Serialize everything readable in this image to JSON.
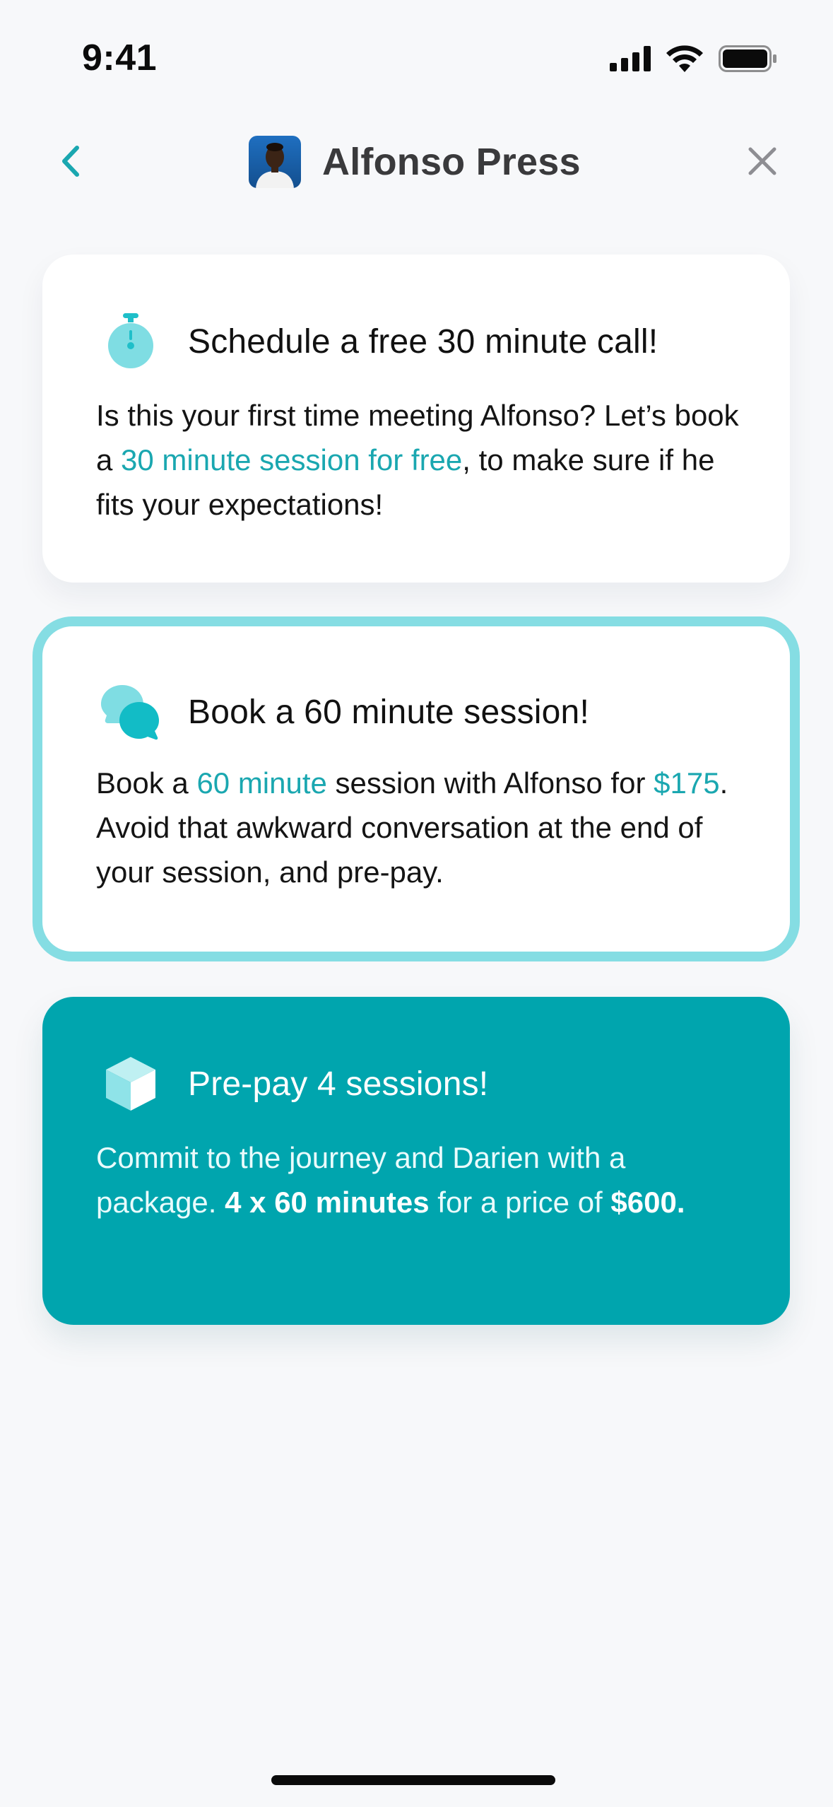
{
  "status_bar": {
    "time": "9:41"
  },
  "nav": {
    "title": "Alfonso Press",
    "back_icon": "chevron-left-icon",
    "close_icon": "close-icon",
    "accent_color": "#1aa7b0"
  },
  "cards": {
    "free_call": {
      "title": "Schedule a free 30 minute call!",
      "icon": "stopwatch-icon",
      "body_1": "Is this your first time meeting Alfonso? Let’s book a ",
      "body_highlight": "30 minute session for free",
      "body_2": ", to make sure if he fits your expectations!"
    },
    "session": {
      "title": "Book a 60 minute session!",
      "icon": "chat-bubbles-icon",
      "body_1": "Book a ",
      "body_highlight_1": "60 minute",
      "body_2": " session with Alfonso for ",
      "body_highlight_2": "$175",
      "body_3": ". Avoid that awkward conversation at the end of your session, and pre-pay.",
      "border_color": "#85dde3"
    },
    "package": {
      "title": "Pre-pay 4 sessions!",
      "icon": "cube-icon",
      "body_1": "Commit to the journey and Darien with a package. ",
      "body_bold_1": "4 x 60 minutes",
      "body_2": " for a price of ",
      "body_bold_2": "$600.",
      "background_color": "#00a5ae"
    }
  }
}
